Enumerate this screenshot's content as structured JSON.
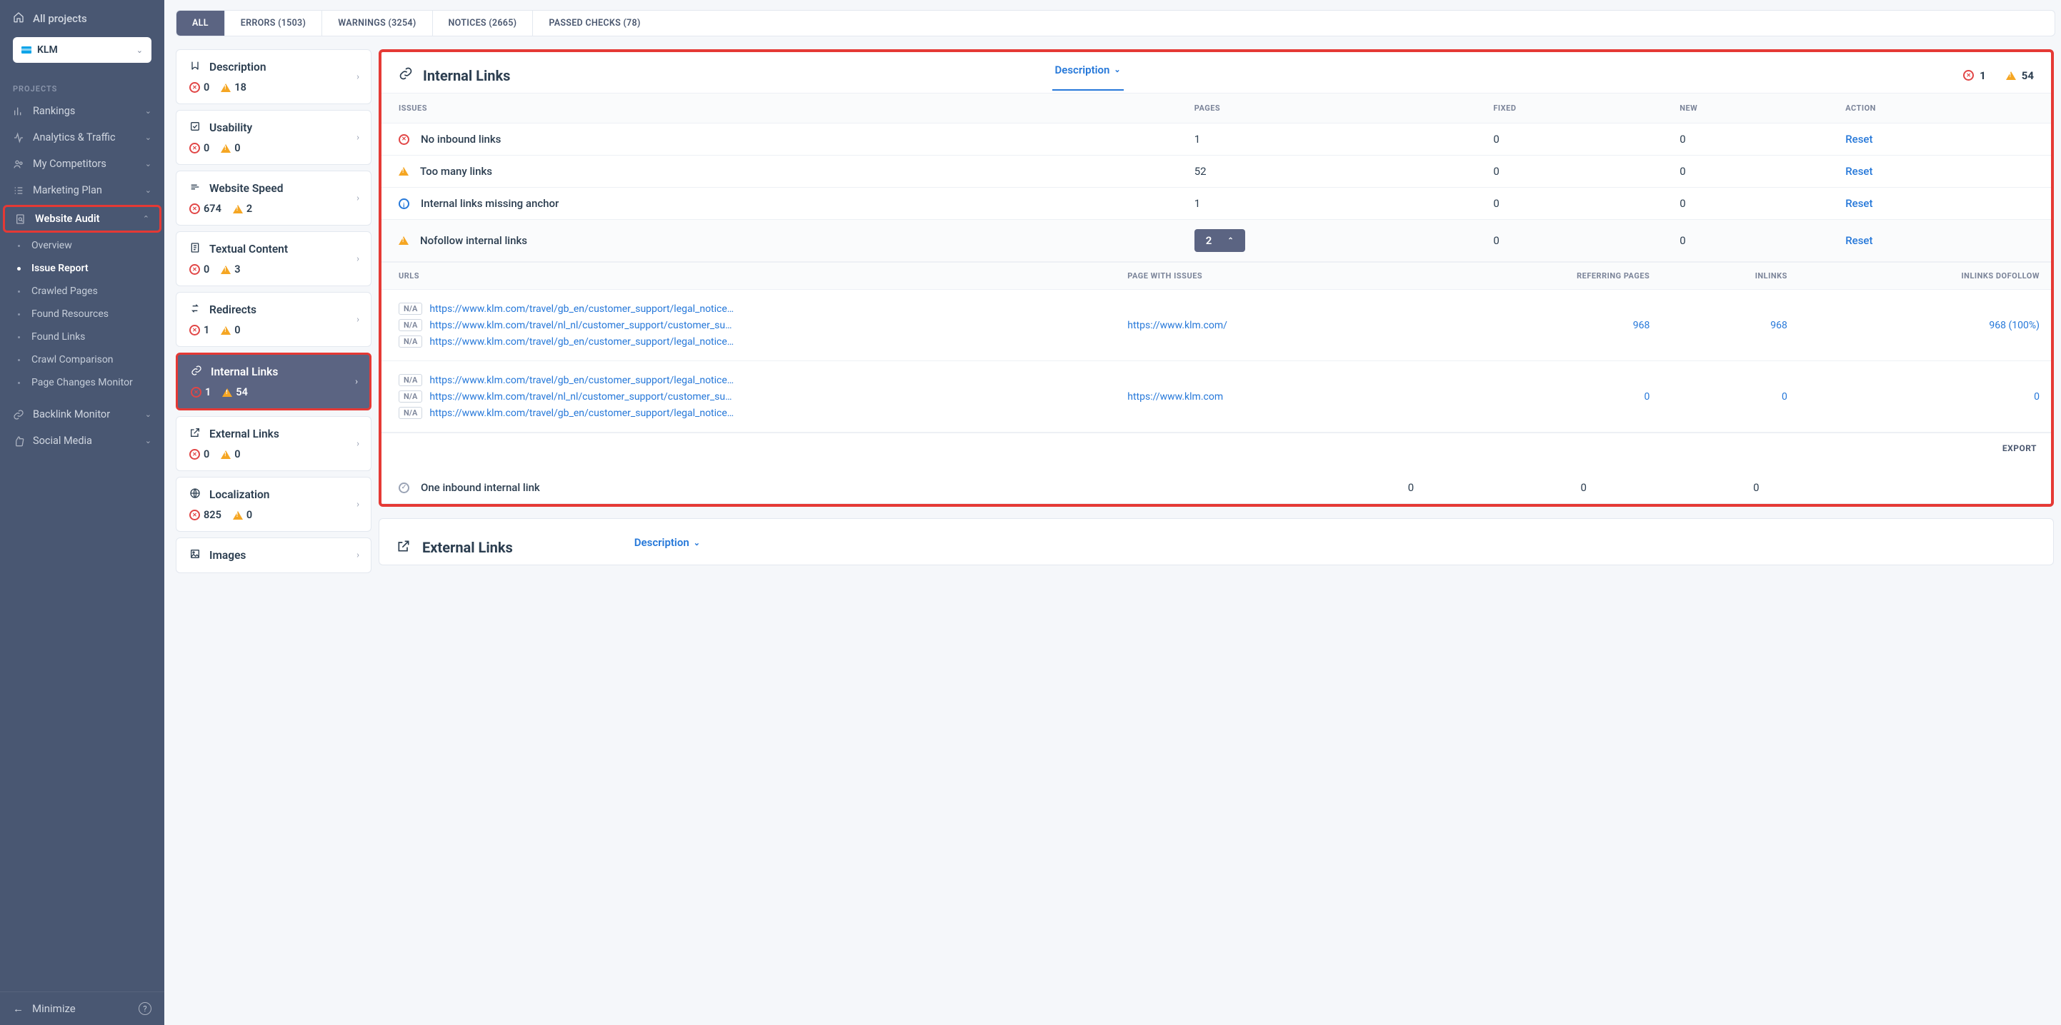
{
  "sidebar": {
    "allProjects": "All projects",
    "project": "KLM",
    "sectionLabel": "PROJECTS",
    "items": [
      {
        "label": "Rankings",
        "iconName": "bars-icon"
      },
      {
        "label": "Analytics & Traffic",
        "iconName": "pulse-icon"
      },
      {
        "label": "My Competitors",
        "iconName": "users-icon"
      },
      {
        "label": "Marketing Plan",
        "iconName": "list-icon"
      }
    ],
    "websiteAudit": {
      "label": "Website Audit"
    },
    "auditSubs": [
      {
        "label": "Overview"
      },
      {
        "label": "Issue Report",
        "active": true
      },
      {
        "label": "Crawled Pages"
      },
      {
        "label": "Found Resources"
      },
      {
        "label": "Found Links"
      },
      {
        "label": "Crawl Comparison"
      },
      {
        "label": "Page Changes Monitor"
      }
    ],
    "itemsAfter": [
      {
        "label": "Backlink Monitor",
        "iconName": "link-icon"
      },
      {
        "label": "Social Media",
        "iconName": "thumb-icon"
      }
    ],
    "minimize": "Minimize"
  },
  "filterTabs": {
    "all": "ALL",
    "errors": "ERRORS (1503)",
    "warnings": "WARNINGS (3254)",
    "notices": "NOTICES (2665)",
    "passed": "PASSED CHECKS (78)"
  },
  "categories": [
    {
      "label": "Description",
      "iconSvg": "U",
      "err": "0",
      "warn": "18"
    },
    {
      "label": "Usability",
      "iconSvg": "✓",
      "err": "0",
      "warn": "0"
    },
    {
      "label": "Website Speed",
      "iconSvg": "≡",
      "err": "674",
      "warn": "2"
    },
    {
      "label": "Textual Content",
      "iconSvg": "▤",
      "err": "0",
      "warn": "3"
    },
    {
      "label": "Redirects",
      "iconSvg": "↻",
      "err": "1",
      "warn": "0"
    },
    {
      "label": "Internal Links",
      "iconSvg": "🔗",
      "err": "1",
      "warn": "54",
      "selected": true
    },
    {
      "label": "External Links",
      "iconSvg": "↗",
      "err": "0",
      "warn": "0"
    },
    {
      "label": "Localization",
      "iconSvg": "⊕",
      "err": "825",
      "warn": "0"
    },
    {
      "label": "Images",
      "iconSvg": "▣"
    }
  ],
  "panel": {
    "title": "Internal Links",
    "tabLabel": "Description",
    "errorCount": "1",
    "warnCount": "54",
    "colIssues": "ISSUES",
    "colPages": "PAGES",
    "colFixed": "FIXED",
    "colNew": "NEW",
    "colAction": "ACTION",
    "resetLabel": "Reset",
    "issues": [
      {
        "icon": "err",
        "name": "No inbound links",
        "pages": "1",
        "fixed": "0",
        "new": "0"
      },
      {
        "icon": "warn",
        "name": "Too many links",
        "pages": "52",
        "fixed": "0",
        "new": "0"
      },
      {
        "icon": "info",
        "name": "Internal links missing anchor",
        "pages": "1",
        "fixed": "0",
        "new": "0"
      },
      {
        "icon": "warn",
        "name": "Nofollow internal links",
        "pages": "2",
        "fixed": "0",
        "new": "0",
        "expanded": true
      },
      {
        "icon": "pass",
        "name": "One inbound internal link",
        "pages": "0",
        "fixed": "0",
        "new": "0",
        "afterUrls": true
      }
    ],
    "urlsHeader": {
      "urls": "URLS",
      "pageWith": "PAGE WITH ISSUES",
      "refPages": "REFERRING PAGES",
      "inlinks": "INLINKS",
      "inlinksDo": "INLINKS DOFOLLOW"
    },
    "naLabel": "N/A",
    "urlRows": [
      {
        "urls": [
          "https://www.klm.com/travel/gb_en/customer_support/legal_notice/i...",
          "https://www.klm.com/travel/nl_nl/customer_support/customer_supp...",
          "https://www.klm.com/travel/gb_en/customer_support/legal_notice/a..."
        ],
        "page": "https://www.klm.com/",
        "refPages": "968",
        "inlinks": "968",
        "inlinksDo": "968 (100%)"
      },
      {
        "urls": [
          "https://www.klm.com/travel/gb_en/customer_support/legal_notice/i...",
          "https://www.klm.com/travel/nl_nl/customer_support/customer_supp...",
          "https://www.klm.com/travel/gb_en/customer_support/legal_notice/a..."
        ],
        "page": "https://www.klm.com",
        "refPages": "0",
        "inlinks": "0",
        "inlinksDo": "0"
      }
    ],
    "export": "EXPORT"
  },
  "panel2": {
    "title": "External Links",
    "tabLabel": "Description"
  }
}
